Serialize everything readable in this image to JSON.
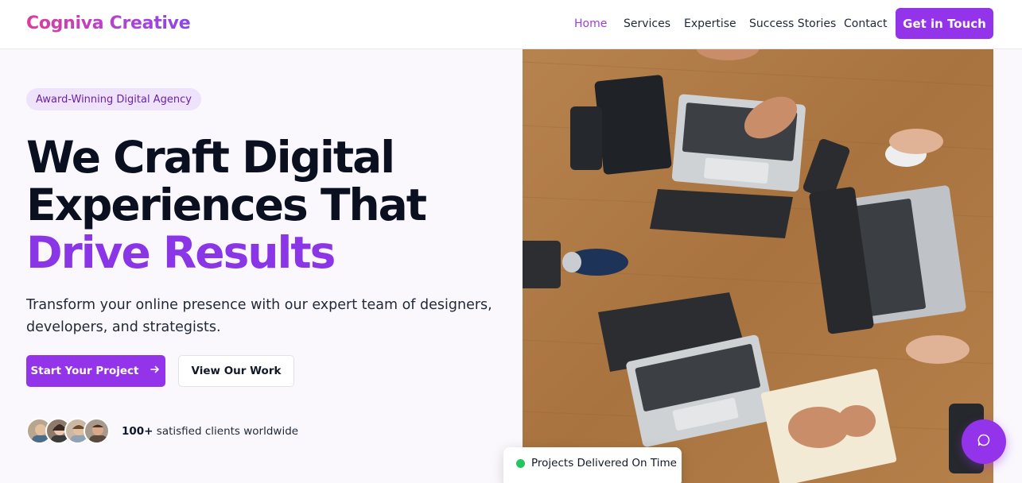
{
  "brand": {
    "name": "Cogniva Creative"
  },
  "nav": {
    "items": [
      {
        "label": "Home",
        "active": true
      },
      {
        "label": "Services",
        "active": false
      },
      {
        "label": "Expertise",
        "active": false
      },
      {
        "label": "Success Stories",
        "active": false
      },
      {
        "label": "Contact",
        "active": false
      }
    ],
    "cta_label": "Get in Touch"
  },
  "hero": {
    "badge": "Award-Winning Digital Agency",
    "headline_line1": "We Craft Digital",
    "headline_line2": "Experiences That",
    "headline_accent": "Drive Results",
    "subtext": "Transform your online presence with our expert team of designers, developers, and strategists.",
    "primary_button": "Start Your Project",
    "secondary_button": "View Our Work",
    "clients_count": "100+",
    "clients_text": "satisfied clients worldwide"
  },
  "status_card": {
    "text": "Projects Delivered On Time",
    "dot_color": "#22c55e"
  },
  "colors": {
    "accent": "#9333ea",
    "accent_text": "#8a35e6",
    "badge_bg": "#efe3fb"
  },
  "icons": {
    "arrow": "arrow-right-icon",
    "chat": "chat-bubble-icon"
  }
}
